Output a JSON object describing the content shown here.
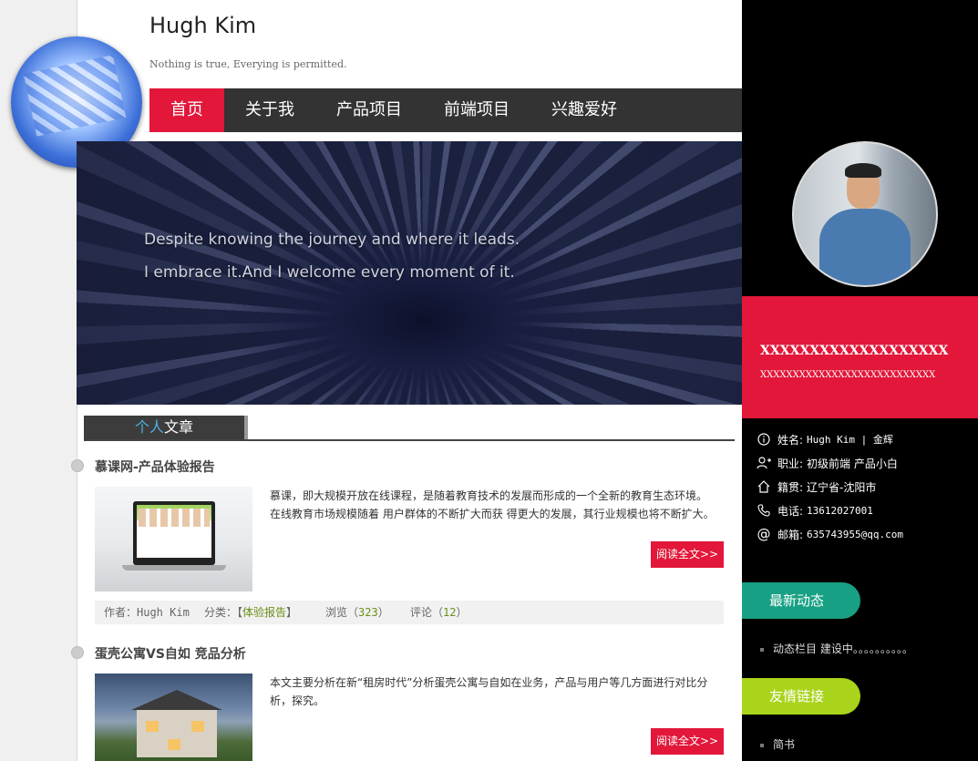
{
  "site": {
    "title": "Hugh Kim",
    "motto": "Nothing is true, Everying is permitted."
  },
  "nav": {
    "items": [
      {
        "label": "首页",
        "active": true
      },
      {
        "label": "关于我",
        "active": false
      },
      {
        "label": "产品项目",
        "active": false
      },
      {
        "label": "前端项目",
        "active": false
      },
      {
        "label": "兴趣爱好",
        "active": false
      }
    ]
  },
  "banner": {
    "line1": "Despite knowing the journey and where it leads.",
    "line2": "I embrace it.And I welcome every moment of it."
  },
  "section": {
    "title_highlight": "个人",
    "title_rest": "文章"
  },
  "posts": [
    {
      "title": "慕课网-产品体验报告",
      "excerpt_line1": "慕课，即大规模开放在线课程，是随着教育技术的发展而形成的一个全新的教育生态环境。",
      "excerpt_line2": "在线教育市场规模随着 用户群体的不断扩大而获 得更大的发展，其行业规模也将不断扩大。",
      "read_more": "阅读全文>>",
      "meta": {
        "author": "作者：Hugh Kim",
        "category_prefix": "分类：【",
        "category": "体验报告",
        "category_suffix": "】",
        "views_prefix": "浏览（",
        "views": "323",
        "views_suffix": "）",
        "comments_prefix": "评论（",
        "comments": "12",
        "comments_suffix": "）"
      }
    },
    {
      "title": "蛋壳公寓VS自如 竞品分析",
      "excerpt": "本文主要分析在新“租房时代”分析蛋壳公寓与自如在业务，产品与用户等几方面进行对比分析，探究。",
      "read_more": "阅读全文>>"
    }
  ],
  "sidebar": {
    "red_title": "XXXXXXXXXXXXXXXXXXX",
    "red_subtitle": "XXXXXXXXXXXXXXXXXXXXXXXXXXX",
    "info": [
      {
        "icon": "info-icon",
        "label": "姓名:",
        "value": "Hugh Kim | 金辉"
      },
      {
        "icon": "user-add-icon",
        "label": "职业:",
        "value": "初级前端 产品小白"
      },
      {
        "icon": "home-icon",
        "label": "籍贯:",
        "value": "辽宁省-沈阳市"
      },
      {
        "icon": "phone-icon",
        "label": "电话:",
        "value": "13612027001"
      },
      {
        "icon": "at-icon",
        "label": "邮箱:",
        "value": "635743955@qq.com"
      }
    ],
    "news_label": "最新动态",
    "news_item": "动态栏目 建设中。。。。。。。。。。",
    "links_label": "友情链接",
    "link_item": "简书"
  },
  "colors": {
    "accent_red": "#e2173a",
    "teal": "#17a083",
    "lime": "#a9d41b",
    "nav_dark": "#333333",
    "sidebar_bg": "#000000"
  }
}
